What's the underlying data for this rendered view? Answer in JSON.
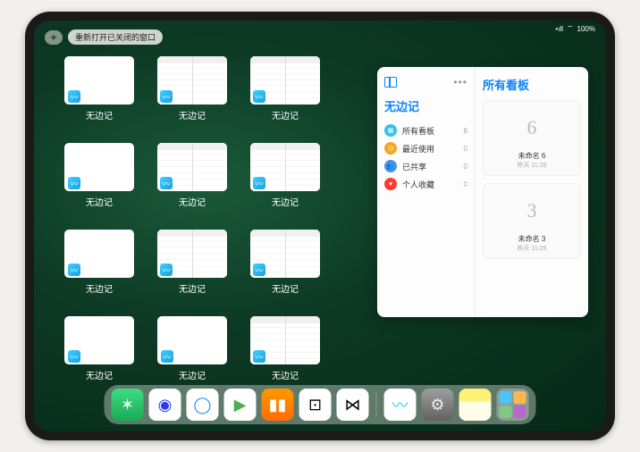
{
  "statusBar": {
    "signal": "•ıll",
    "wifi": "⌔",
    "battery": "100%"
  },
  "topControls": {
    "addLabel": "+",
    "reopenLabel": "重新打开已关闭的窗口"
  },
  "windows": [
    {
      "label": "无边记",
      "split": false
    },
    {
      "label": "无边记",
      "split": true
    },
    {
      "label": "无边记",
      "split": true
    },
    {
      "label": "无边记",
      "split": false
    },
    {
      "label": "无边记",
      "split": true
    },
    {
      "label": "无边记",
      "split": true
    },
    {
      "label": "无边记",
      "split": false
    },
    {
      "label": "无边记",
      "split": true
    },
    {
      "label": "无边记",
      "split": true
    },
    {
      "label": "无边记",
      "split": false
    },
    {
      "label": "无边记",
      "split": false
    },
    {
      "label": "无边记",
      "split": true
    }
  ],
  "sidebarPanel": {
    "leftTitle": "无边记",
    "rightTitle": "所有看板",
    "items": [
      {
        "icon": "grid",
        "color": "#34c3ee",
        "label": "所有看板",
        "count": 8
      },
      {
        "icon": "clock",
        "color": "#f5a623",
        "label": "最近使用",
        "count": 0
      },
      {
        "icon": "people",
        "color": "#4a90e2",
        "label": "已共享",
        "count": 0
      },
      {
        "icon": "heart",
        "color": "#ff3b30",
        "label": "个人收藏",
        "count": 0
      }
    ],
    "boards": [
      {
        "glyph": "6",
        "name": "未命名 6",
        "date": "昨天 11:26"
      },
      {
        "glyph": "3",
        "name": "未命名 3",
        "date": "昨天 11:26"
      }
    ]
  },
  "dock": {
    "apps": [
      {
        "name": "wechat",
        "bg": "linear-gradient(#3ddc84,#1aaa55)",
        "glyph": "✶",
        "glyphColor": "#fff"
      },
      {
        "name": "quark",
        "bg": "#fff",
        "glyph": "◉",
        "glyphColor": "#2a3ee8"
      },
      {
        "name": "qqbrowser",
        "bg": "#fff",
        "glyph": "◯",
        "glyphColor": "#1e90ff"
      },
      {
        "name": "play",
        "bg": "#fff",
        "glyph": "▶",
        "glyphColor": "#4caf50"
      },
      {
        "name": "books",
        "bg": "linear-gradient(#ff9800,#ff6d00)",
        "glyph": "▮▮",
        "glyphColor": "#fff"
      },
      {
        "name": "dice",
        "bg": "#fff",
        "glyph": "⊡",
        "glyphColor": "#000"
      },
      {
        "name": "connect",
        "bg": "#fff",
        "glyph": "⋈",
        "glyphColor": "#000"
      }
    ],
    "recent": [
      {
        "name": "freeform",
        "bg": "#fff",
        "glyph": "〰",
        "glyphColor": "#1ac8ed"
      },
      {
        "name": "settings",
        "bg": "linear-gradient(#9e9e9e,#616161)",
        "glyph": "⚙",
        "glyphColor": "#eee"
      },
      {
        "name": "notes",
        "bg": "linear-gradient(#fff176 0 40%,#fffde7 40%)",
        "glyph": "",
        "glyphColor": ""
      }
    ]
  }
}
